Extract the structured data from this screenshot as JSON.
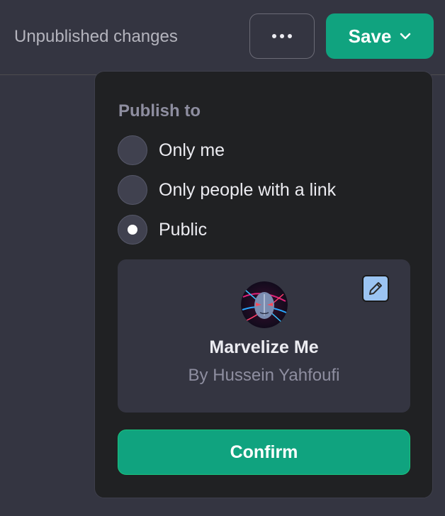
{
  "header": {
    "status": "Unpublished changes",
    "more_icon": "ellipsis-icon",
    "save_label": "Save",
    "save_icon": "chevron-down-icon"
  },
  "publish": {
    "heading": "Publish to",
    "options": [
      {
        "label": "Only me",
        "selected": false
      },
      {
        "label": "Only people with a link",
        "selected": false
      },
      {
        "label": "Public",
        "selected": true
      }
    ]
  },
  "gpt_card": {
    "name": "Marvelize Me",
    "author": "By Hussein Yahfoufi",
    "edit_icon": "pencil-icon",
    "avatar": "gpt-avatar"
  },
  "confirm_label": "Confirm",
  "colors": {
    "accent": "#10a37f",
    "background": "#343541",
    "popover": "#202123"
  }
}
